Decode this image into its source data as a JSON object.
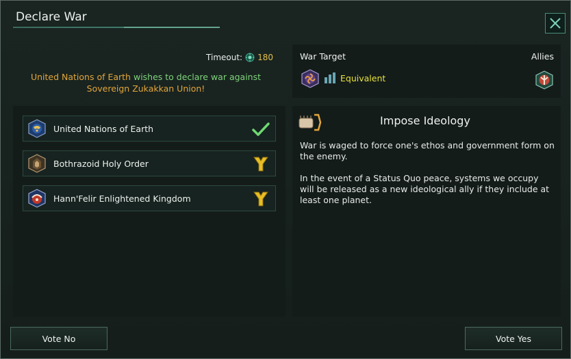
{
  "window": {
    "title": "Declare War",
    "close_icon": "close-icon"
  },
  "header": {
    "timeout_label": "Timeout:",
    "timeout_value": "180",
    "timeout_icon": "influence-icon",
    "announcement": {
      "actor": "United Nations of Earth",
      "verb": "wishes to declare war against",
      "target": "Sovereign Zukakkan Union!"
    }
  },
  "empires": [
    {
      "name": "United Nations of Earth",
      "emblem": "earth-emblem",
      "vote": "yes",
      "vote_icon": "checkmark-icon"
    },
    {
      "name": "Bothrazoid Holy Order",
      "emblem": "holy-order-emblem",
      "vote": "pending",
      "vote_icon": "undecided-icon"
    },
    {
      "name": "Hann'Felir Enlightened Kingdom",
      "emblem": "kingdom-emblem",
      "vote": "pending",
      "vote_icon": "undecided-icon"
    }
  ],
  "war_target": {
    "label": "War Target",
    "allies_label": "Allies",
    "target_emblem": "zukakkan-emblem",
    "strength_icon": "strength-bars-icon",
    "strength_text": "Equivalent",
    "ally_emblem": "ally-emblem"
  },
  "war_goal": {
    "icon": "fist-icon",
    "title": "Impose Ideology",
    "paragraphs": [
      "War is waged to force one's ethos and government form on the enemy.",
      "In the event of a Status Quo peace, systems we occupy will be released as a new ideological ally if they include at least one planet."
    ]
  },
  "buttons": {
    "vote_no": "Vote No",
    "vote_yes": "Vote Yes"
  },
  "colors": {
    "accent": "#4a8f7c",
    "orange": "#e3a63b",
    "green": "#7fd37b",
    "yellow": "#e8e23a",
    "gold": "#e3c04a"
  }
}
